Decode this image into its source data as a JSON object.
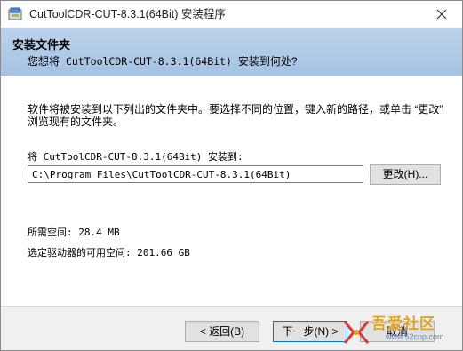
{
  "window": {
    "title": "CutToolCDR-CUT-8.3.1(64Bit) 安装程序"
  },
  "header": {
    "title": "安装文件夹",
    "subtitle_prefix": "您想将",
    "subtitle_product": "CutToolCDR-CUT-8.3.1(64Bit)",
    "subtitle_suffix": "安装到何处?"
  },
  "content": {
    "description": "软件将被安装到以下列出的文件夹中。要选择不同的位置，键入新的路径，或单击 “更改” 浏览现有的文件夹。",
    "install_label": "将 CutToolCDR-CUT-8.3.1(64Bit) 安装到:",
    "install_path": "C:\\Program Files\\CutToolCDR-CUT-8.3.1(64Bit)",
    "change_button": "更改(H)...",
    "space_required": "所需空间: 28.4 MB",
    "space_available": "选定驱动器的可用空间: 201.66 GB"
  },
  "footer": {
    "back_button": "< 返回(B)",
    "next_button": "下一步(N) >",
    "cancel_button": "取消"
  },
  "watermark": {
    "text": "吾爱社区",
    "url": "www.52cnp.com"
  },
  "colors": {
    "header_gradient_top": "#bcd3ec",
    "header_gradient_bottom": "#a6c2e2",
    "button_face": "#e1e1e1",
    "focus_border": "#0078d7"
  },
  "icons": {
    "app": "installer-app-icon",
    "close": "close-icon"
  }
}
